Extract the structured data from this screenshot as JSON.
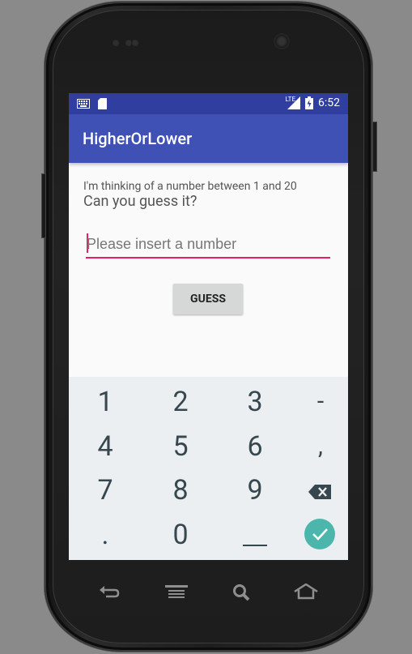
{
  "statusbar": {
    "time": "6:52",
    "network": "LTE"
  },
  "appbar": {
    "title": "HigherOrLower"
  },
  "content": {
    "line1": "I'm thinking of a number between 1 and 20",
    "line2": "Can you guess it?",
    "input_placeholder": "Please insert a number",
    "input_value": "",
    "guess_label": "GUESS"
  },
  "keypad": {
    "rows": [
      [
        "1",
        "2",
        "3",
        "-"
      ],
      [
        "4",
        "5",
        "6",
        ","
      ],
      [
        "7",
        "8",
        "9",
        "backspace"
      ],
      [
        ".",
        "0",
        "space",
        "done"
      ]
    ],
    "labels": {
      "k1": "1",
      "k2": "2",
      "k3": "3",
      "kminus": "-",
      "k4": "4",
      "k5": "5",
      "k6": "6",
      "kcomma": ",",
      "k7": "7",
      "k8": "8",
      "k9": "9",
      "kdot": ".",
      "k0": "0",
      "kspace": "__"
    }
  },
  "colors": {
    "statusbar": "#303f9f",
    "appbar": "#3f51b5",
    "accent": "#e91e63",
    "done": "#4db6ac"
  },
  "icons": {
    "statusbar_left": [
      "keyboard-icon",
      "sd-card-icon"
    ],
    "statusbar_right": [
      "signal-icon",
      "battery-icon"
    ],
    "navbar": [
      "back-icon",
      "menu-icon",
      "search-icon",
      "home-icon"
    ]
  }
}
